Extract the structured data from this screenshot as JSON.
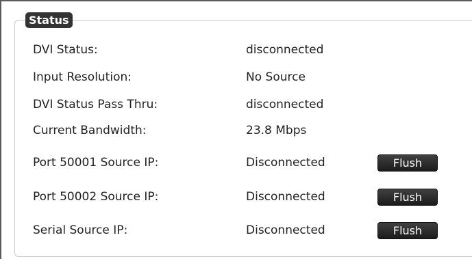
{
  "status": {
    "legend": "Status",
    "rows": [
      {
        "label": "DVI Status:",
        "value": "disconnected"
      },
      {
        "label": "Input Resolution:",
        "value": "No Source"
      },
      {
        "label": "DVI Status Pass Thru:",
        "value": "disconnected"
      },
      {
        "label": "Current Bandwidth:",
        "value": "23.8 Mbps"
      },
      {
        "label": "Port 50001 Source IP:",
        "value": "Disconnected",
        "button": "Flush"
      },
      {
        "label": "Port 50002 Source IP:",
        "value": "Disconnected",
        "button": "Flush"
      },
      {
        "label": "Serial Source IP:",
        "value": "Disconnected",
        "button": "Flush"
      }
    ]
  }
}
